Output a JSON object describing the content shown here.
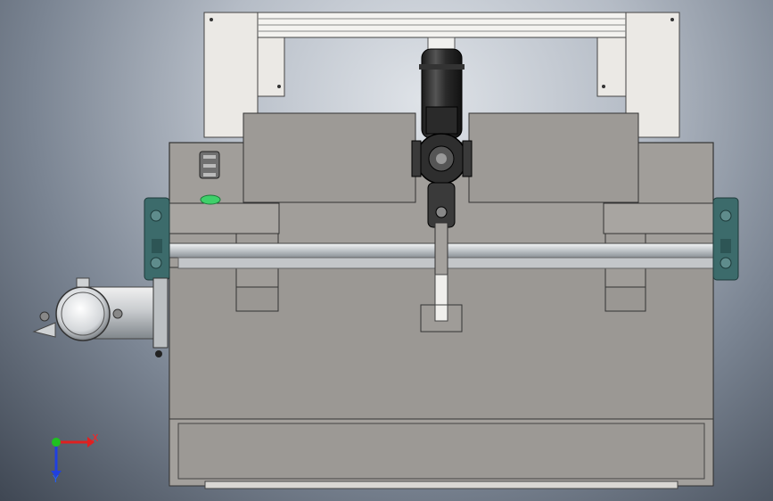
{
  "view": {
    "type": "cad-model-viewport",
    "background": "#7b8593"
  },
  "triad": {
    "x_label": "X",
    "y_label": "Y",
    "x_color": "#e02020",
    "y_color": "#2040e0",
    "z_color": "#20c020"
  },
  "colors": {
    "body_gray": "#9e9b97",
    "frame_white": "#e8e6e2",
    "bearing_teal": "#3f6f6f",
    "cylinder_dark": "#2b2b2b",
    "indicator_green": "#3fd06a",
    "shaft_silver": "#cfd3d6"
  }
}
